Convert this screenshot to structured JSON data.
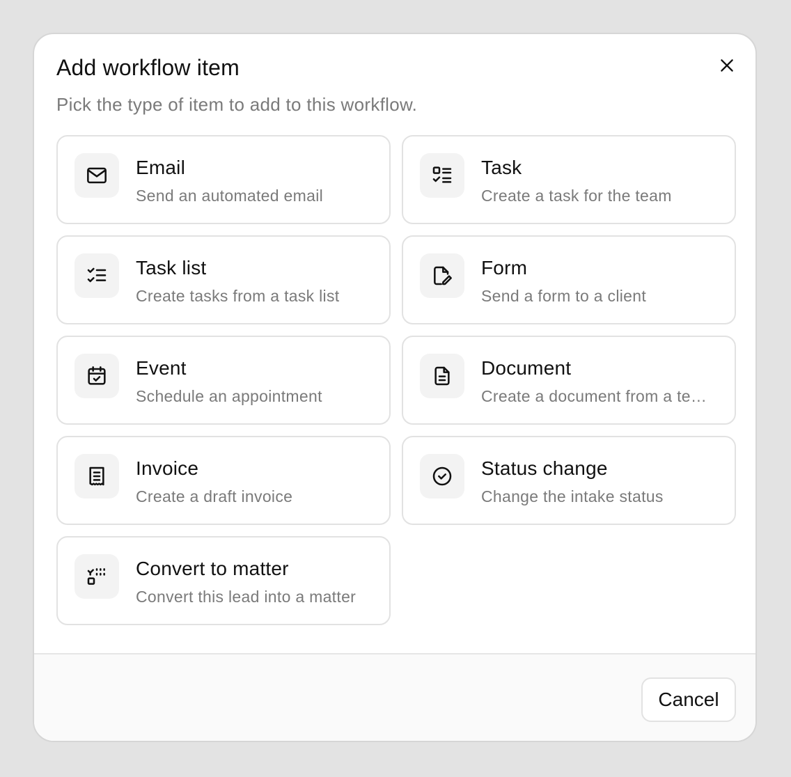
{
  "dialog": {
    "title": "Add workflow item",
    "subtitle": "Pick the type of item to add to this workflow.",
    "close_icon": "close-icon"
  },
  "items": [
    {
      "name": "email",
      "icon": "mail-icon",
      "title": "Email",
      "description": "Send an automated email"
    },
    {
      "name": "task",
      "icon": "task-icon",
      "title": "Task",
      "description": "Create a task for the team"
    },
    {
      "name": "task-list",
      "icon": "checklist-icon",
      "title": "Task list",
      "description": "Create tasks from a task list"
    },
    {
      "name": "form",
      "icon": "form-edit-icon",
      "title": "Form",
      "description": "Send a form to a client"
    },
    {
      "name": "event",
      "icon": "calendar-check-icon",
      "title": "Event",
      "description": "Schedule an appointment"
    },
    {
      "name": "document",
      "icon": "document-icon",
      "title": "Document",
      "description": "Create a document from a te…"
    },
    {
      "name": "invoice",
      "icon": "receipt-icon",
      "title": "Invoice",
      "description": "Create a draft invoice"
    },
    {
      "name": "status-change",
      "icon": "check-circle-icon",
      "title": "Status change",
      "description": "Change the intake status"
    },
    {
      "name": "convert-to-matter",
      "icon": "convert-icon",
      "title": "Convert to matter",
      "description": "Convert this lead into a matter"
    }
  ],
  "footer": {
    "cancel_label": "Cancel"
  },
  "colors": {
    "backdrop": "#e3e3e3",
    "surface": "#ffffff",
    "border": "#e2e2e2",
    "icon_tile": "#f3f3f3",
    "text_primary": "#111111",
    "text_secondary": "#7a7a7a",
    "footer_bg": "#fafafa"
  }
}
